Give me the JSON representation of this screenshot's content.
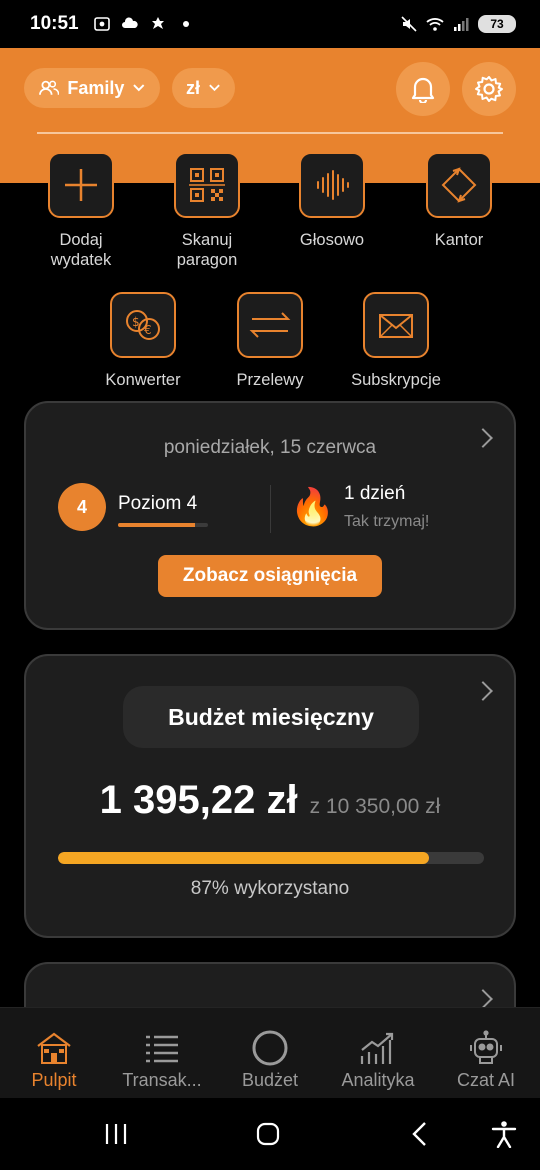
{
  "status_bar": {
    "time": "10:51",
    "battery": "73"
  },
  "header": {
    "profile_label": "Family",
    "currency_label": "zł"
  },
  "quick_actions": [
    {
      "label": "Dodaj\nwydatek",
      "icon": "plus-icon"
    },
    {
      "label": "Skanuj\nparagon",
      "icon": "qr-scan-icon"
    },
    {
      "label": "Głosowo",
      "icon": "voice-wave-icon"
    },
    {
      "label": "Kantor",
      "icon": "exchange-rotate-icon"
    },
    {
      "label": "Konwerter",
      "icon": "currency-convert-icon"
    },
    {
      "label": "Przelewy",
      "icon": "transfer-arrows-icon"
    },
    {
      "label": "Subskrypcje",
      "icon": "envelope-icon"
    }
  ],
  "daily_card": {
    "date": "poniedziałek, 15 czerwca",
    "level_number": "4",
    "level_label": "Poziom 4",
    "level_progress": 0.85,
    "streak_emoji": "🔥",
    "streak_title": "1 dzień",
    "streak_subtitle": "Tak trzymaj!",
    "achievements_button": "Zobacz osiągnięcia"
  },
  "budget_card": {
    "title": "Budżet miesięczny",
    "spent": "1 395,22 zł",
    "total": "z 10 350,00 zł",
    "used_fraction": 0.87,
    "used_label": "87% wykorzystano"
  },
  "bottom_nav": [
    {
      "label": "Pulpit",
      "icon": "house-icon",
      "active": true
    },
    {
      "label": "Transak...",
      "icon": "list-icon",
      "active": false
    },
    {
      "label": "Budżet",
      "icon": "ring-icon",
      "active": false
    },
    {
      "label": "Analityka",
      "icon": "growth-chart-icon",
      "active": false
    },
    {
      "label": "Czat AI",
      "icon": "robot-icon",
      "active": false
    }
  ],
  "colors": {
    "accent": "#e8832e",
    "budget_bar": "#f5a623",
    "card_bg": "#1e1e1e"
  }
}
